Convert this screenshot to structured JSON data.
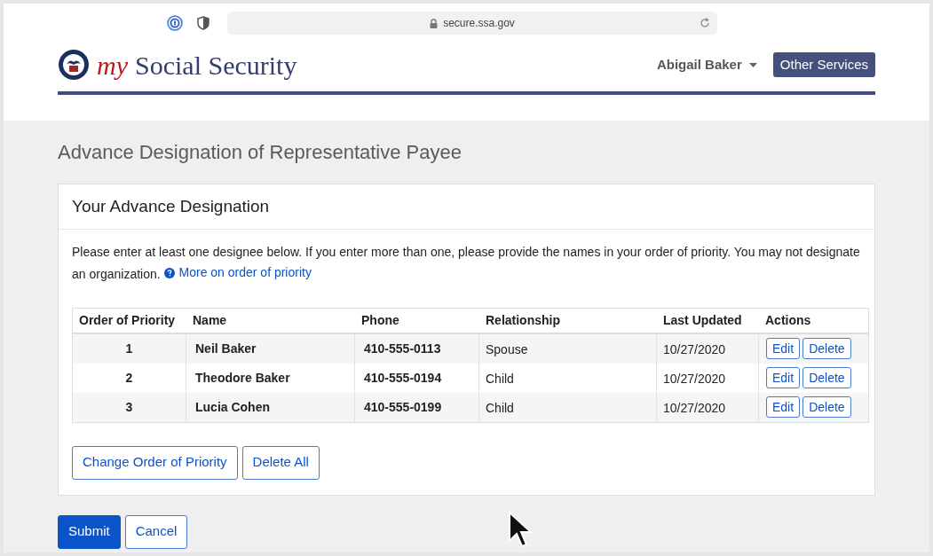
{
  "browser": {
    "url": "secure.ssa.gov"
  },
  "header": {
    "logo_prefix": "my",
    "logo_text": "Social Security",
    "user_menu": "Abigail Baker",
    "other_services": "Other Services"
  },
  "page_title": "Advance Designation of Representative Payee",
  "card": {
    "title": "Your Advance Designation",
    "intro": "Please enter at least one designee below. If you enter more than one, please provide the names in your order of priority. You may not designate an organization.",
    "help_link": "More on order of priority",
    "table": {
      "columns": [
        "Order of Priority",
        "Name",
        "Phone",
        "Relationship",
        "Last Updated",
        "Actions"
      ],
      "rows": [
        {
          "order": "1",
          "name": "Neil Baker",
          "phone": "410-555-0113",
          "relationship": "Spouse",
          "last_updated": "10/27/2020",
          "actions": [
            "Edit",
            "Delete"
          ]
        },
        {
          "order": "2",
          "name": "Theodore Baker",
          "phone": "410-555-0194",
          "relationship": "Child",
          "last_updated": "10/27/2020",
          "actions": [
            "Edit",
            "Delete"
          ]
        },
        {
          "order": "3",
          "name": "Lucia Cohen",
          "phone": "410-555-0199",
          "relationship": "Child",
          "last_updated": "10/27/2020",
          "actions": [
            "Edit",
            "Delete"
          ]
        }
      ]
    },
    "buttons": [
      "Change Order of Priority",
      "Delete All"
    ]
  },
  "form_buttons": [
    {
      "label": "Submit",
      "kind": "primary"
    },
    {
      "label": "Cancel",
      "kind": "secondary"
    }
  ]
}
